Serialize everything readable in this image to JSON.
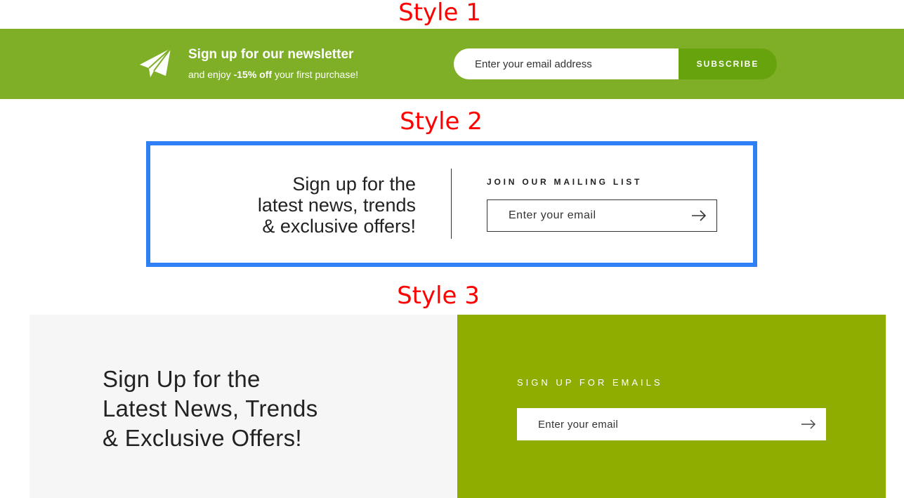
{
  "labels": {
    "style1": "Style 1",
    "style2": "Style 2",
    "style3": "Style 3"
  },
  "style1": {
    "icon": "paper-plane-icon",
    "title": "Sign up for our newsletter",
    "subtitle_pre": "and enjoy ",
    "subtitle_bold": "-15% off",
    "subtitle_post": " your first purchase!",
    "email_placeholder": "Enter your email address",
    "button_label": "SUBSCRIBE",
    "background_color": "#7faf27",
    "button_color": "#67a30d"
  },
  "style2": {
    "heading_lines": [
      "Sign up for the",
      "latest news, trends",
      "& exclusive offers!"
    ],
    "label": "JOIN OUR MAILING LIST",
    "email_placeholder": "Enter your email",
    "submit_icon": "arrow-right-icon",
    "border_color": "#2f7ff7"
  },
  "style3": {
    "heading_lines": [
      "Sign Up for the",
      "Latest News, Trends",
      "& Exclusive Offers!"
    ],
    "label": "SIGN UP FOR EMAILS",
    "email_placeholder": "Enter your email",
    "submit_icon": "arrow-right-icon",
    "left_background": "#f6f6f6",
    "right_background": "#8fac00"
  }
}
